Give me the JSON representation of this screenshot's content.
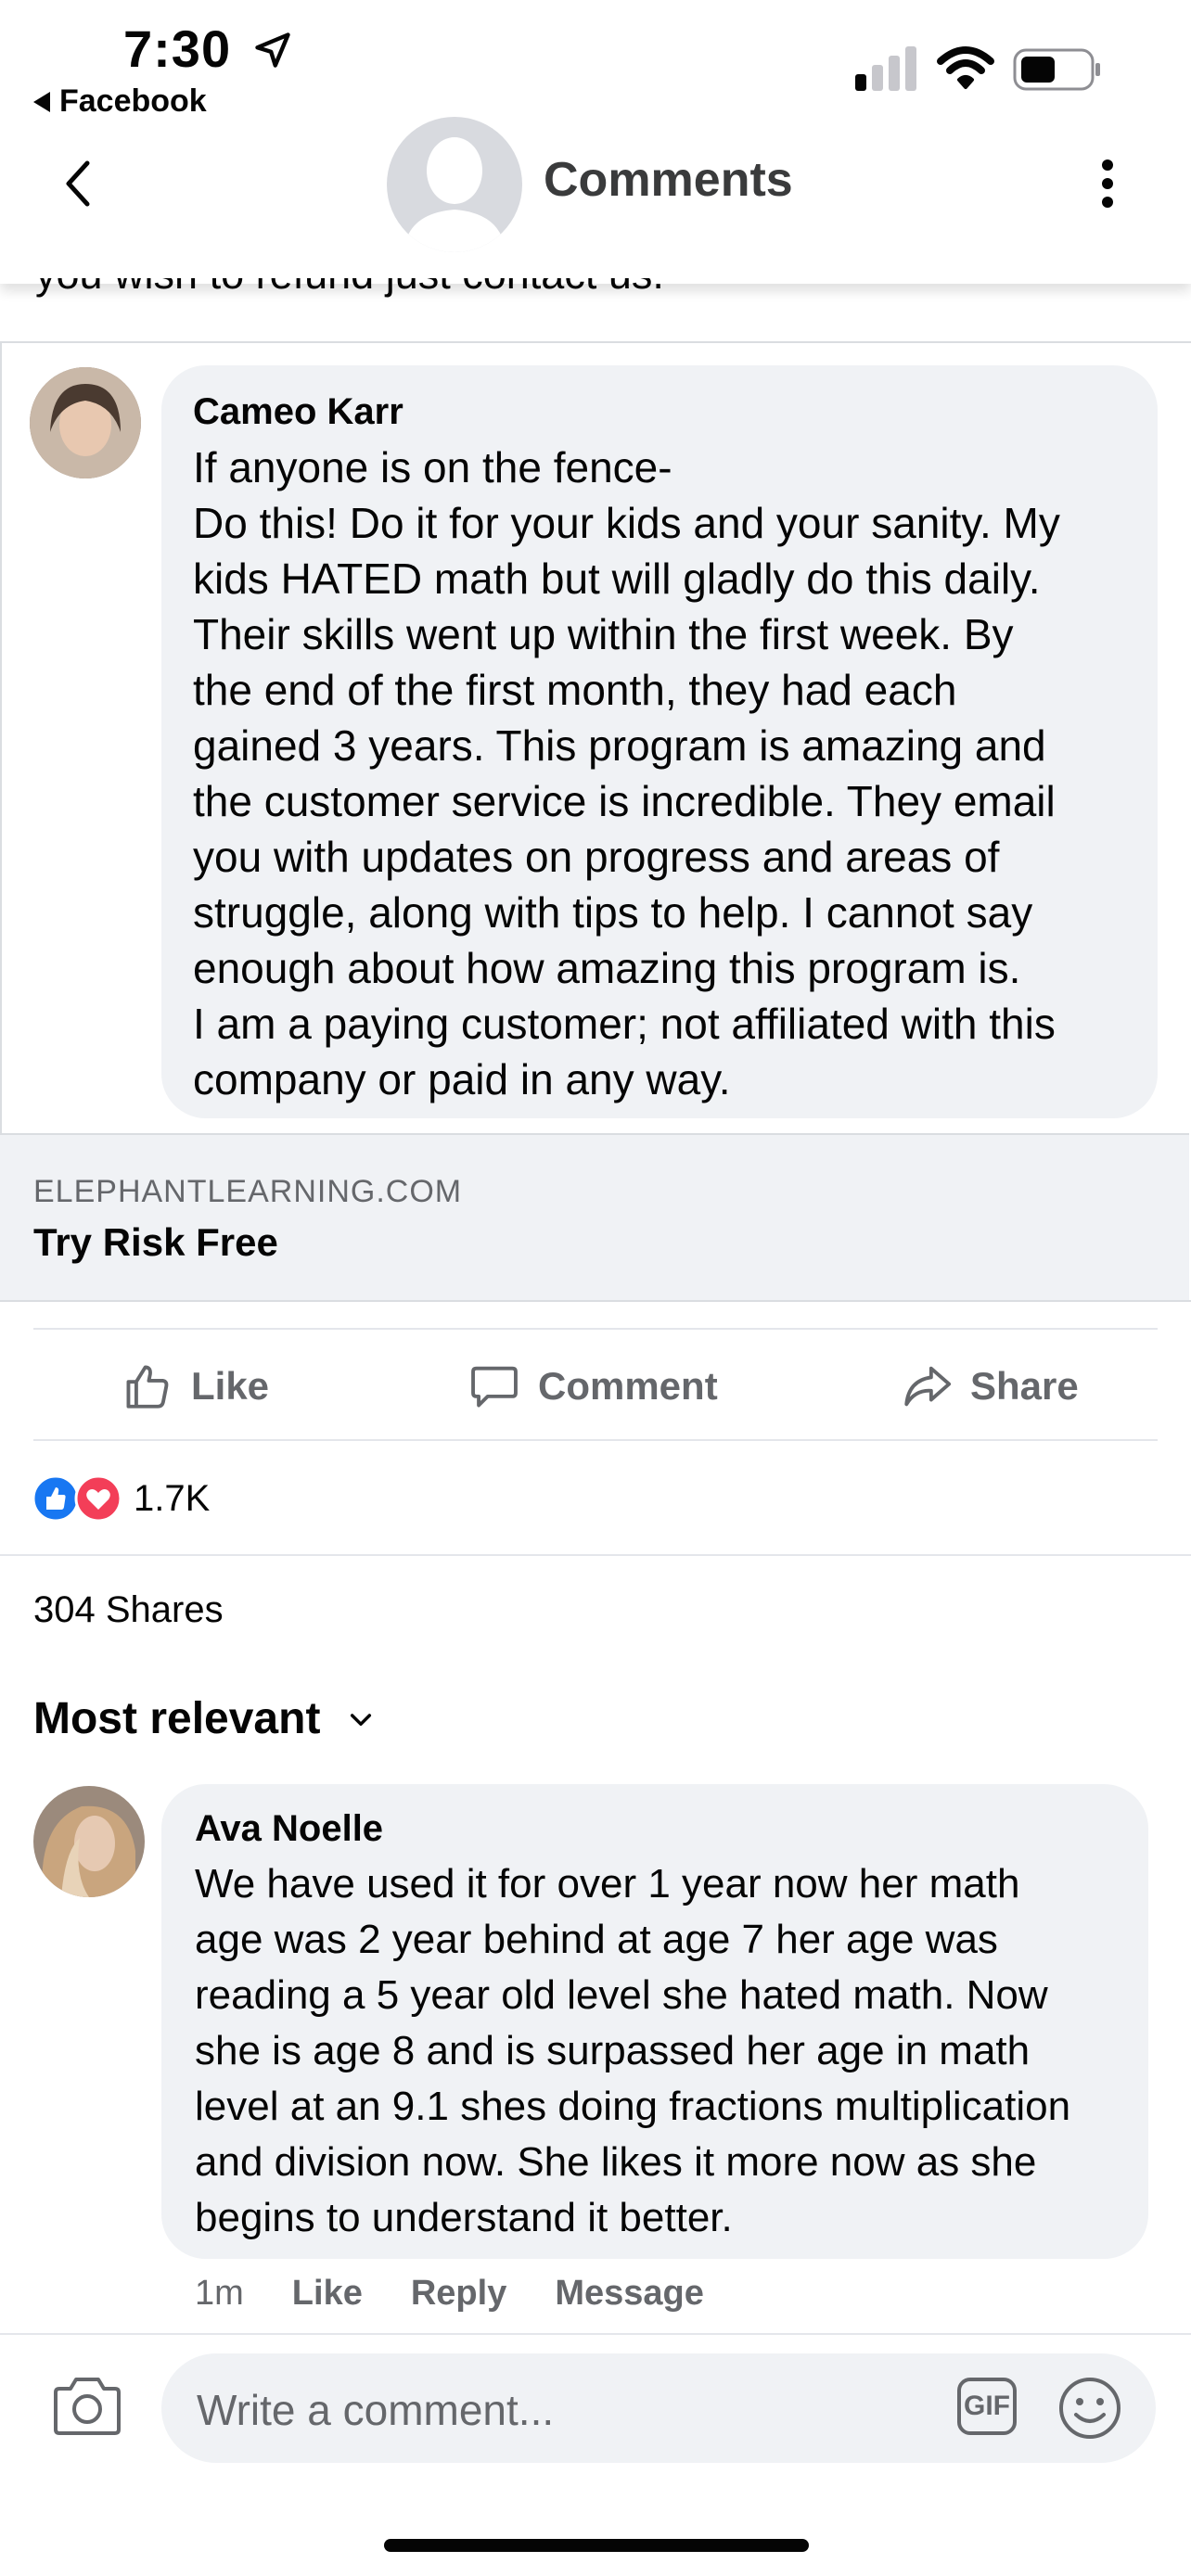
{
  "status_bar": {
    "time": "7:30",
    "back_app": "Facebook"
  },
  "header": {
    "title": "Comments"
  },
  "post": {
    "truncated_text": "you wish to refund just contact us.",
    "featured_comment": {
      "author": "Cameo Karr",
      "lines": [
        "If anyone is on the fence-",
        "Do this! Do it for your kids and your sanity. My",
        "kids HATED math but will gladly do this daily.",
        "Their skills went up within the first week. By",
        "the end of the first month, they had each",
        "gained 3 years. This program is amazing and",
        "the customer service is incredible. They email",
        "you with updates on progress and areas of",
        "struggle, along with tips to help. I cannot say",
        "enough about how amazing this program is.",
        "I am a paying customer; not affiliated with this",
        "company or paid in any way."
      ]
    },
    "link": {
      "domain": "ELEPHANTLEARNING.COM",
      "cta": "Try Risk Free"
    },
    "actions": {
      "like": "Like",
      "comment": "Comment",
      "share": "Share"
    },
    "reaction_count": "1.7K",
    "shares": "304 Shares"
  },
  "sort": {
    "label": "Most relevant"
  },
  "comments": [
    {
      "author": "Ava Noelle",
      "lines": [
        "We have used it for over 1 year now her math",
        "age was 2 year behind at age 7 her age was",
        "reading a 5 year old level she hated math. Now",
        "she is age 8 and is surpassed her age in math",
        "level at an 9.1 shes doing fractions multiplication",
        "and division now. She likes it more now as she",
        "begins to understand it better."
      ],
      "time": "1m",
      "like": "Like",
      "reply": "Reply",
      "message": "Message"
    }
  ],
  "composer": {
    "placeholder": "Write a comment...",
    "gif": "GIF"
  },
  "colors": {
    "like_blue": "#1877f2",
    "love_red": "#f33e58",
    "bubble": "#f0f2f5",
    "secondary_text": "#65676b"
  },
  "icons": [
    "location-arrow-icon",
    "signal-icon",
    "wifi-icon",
    "battery-icon",
    "back-chevron-icon",
    "more-vertical-icon",
    "thumbs-up-icon",
    "comment-icon",
    "share-icon",
    "like-reaction-icon",
    "love-reaction-icon",
    "chevron-down-icon",
    "camera-icon",
    "gif-icon",
    "emoji-icon"
  ]
}
